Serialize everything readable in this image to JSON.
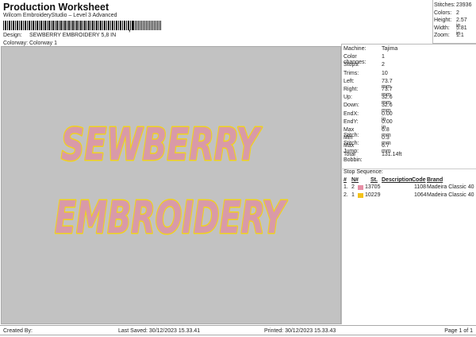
{
  "header": {
    "title": "Production Worksheet",
    "subtitle": "Wilcom EmbroideryStudio – Level 3 Advanced",
    "barcode_comma": ",",
    "design_label": "Design:",
    "design_value": "SEWBERRY EMBROIDERY 5,8 IN",
    "colorway_label": "Colorway:",
    "colorway_value": "Colorway 1"
  },
  "stats": [
    {
      "label": "Stitches:",
      "value": "23936"
    },
    {
      "label": "Colors:",
      "value": "2"
    },
    {
      "label": "Height:",
      "value": "2.57 in"
    },
    {
      "label": "Width:",
      "value": "5.81 in"
    },
    {
      "label": "Zoom:",
      "value": "1:1"
    }
  ],
  "info": [
    {
      "label": "Machine:",
      "value": "Tajima"
    },
    {
      "label": "Color changes:",
      "value": "1"
    },
    {
      "label": "Stops:",
      "value": "2"
    },
    {
      "label": "Trims:",
      "value": "10"
    },
    {
      "label": "Left:",
      "value": "73.7 mm"
    },
    {
      "label": "Right:",
      "value": "73.7 mm"
    },
    {
      "label": "Up:",
      "value": "32.6 mm"
    },
    {
      "label": "Down:",
      "value": "32.6 mm"
    },
    {
      "label": "EndX:",
      "value": "0.00 in"
    },
    {
      "label": "EndY:",
      "value": "0.00 in"
    },
    {
      "label": "Max Stitch:",
      "value": "6.8 mm"
    },
    {
      "label": "Min Stitch:",
      "value": "0.3 mm"
    },
    {
      "label": "Max Jump:",
      "value": "6.7 mm"
    },
    {
      "label": "Total Bobbin:",
      "value": "131.14ft"
    }
  ],
  "stop_sequence": {
    "title": "Stop Sequence:",
    "headers": {
      "num": "#",
      "n": "N#",
      "st": "St.",
      "desc": "Description",
      "code": "Code",
      "brand": "Brand"
    },
    "rows": [
      {
        "num": "1.",
        "n": "2",
        "color": "#e78fa6",
        "st": "13705",
        "code": "1108",
        "brand": "Madeira Classic 40"
      },
      {
        "num": "2.",
        "n": "1",
        "color": "#f3c21a",
        "st": "10229",
        "code": "1064",
        "brand": "Madeira Classic 40"
      }
    ]
  },
  "design": {
    "line1": "SEWBERRY",
    "line2": "EMBROIDERY",
    "fill": "#d99aa8",
    "outline": "#f0d21c"
  },
  "footer": {
    "created": "Created By:",
    "saved": "Last Saved: 30/12/2023 15.33.41",
    "printed": "Printed: 30/12/2023 15.33.43",
    "page": "Page 1 of 1"
  }
}
